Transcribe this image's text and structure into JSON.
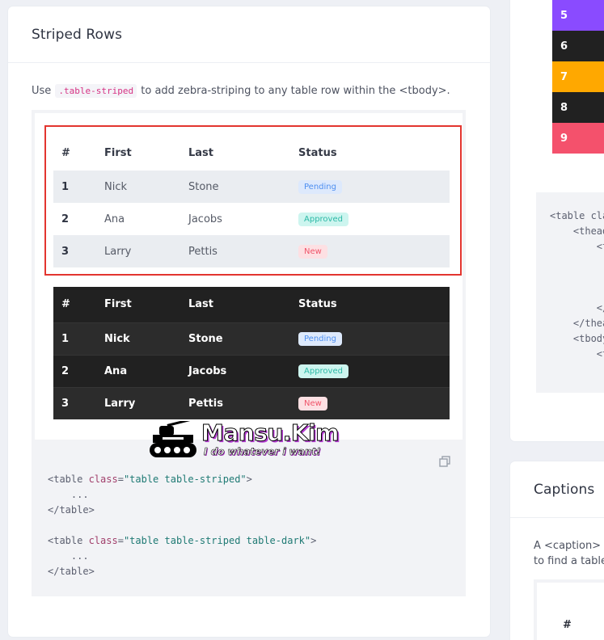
{
  "striped": {
    "title": "Striped Rows",
    "desc_prefix": "Use ",
    "desc_code": ".table-striped",
    "desc_suffix": " to add zebra-striping to any table row within the <tbody>.",
    "headers": [
      "#",
      "First",
      "Last",
      "Status"
    ],
    "rows": [
      {
        "num": "1",
        "first": "Nick",
        "last": "Stone",
        "status": "Pending"
      },
      {
        "num": "2",
        "first": "Ana",
        "last": "Jacobs",
        "status": "Approved"
      },
      {
        "num": "3",
        "first": "Larry",
        "last": "Pettis",
        "status": "New"
      }
    ],
    "code": {
      "l1_open": "<table ",
      "l1_attr": "class",
      "l1_eq": "=",
      "l1_str": "\"table table-striped\"",
      "l1_close": ">",
      "l2": "    ...",
      "l3": "</table>",
      "l5_open": "<table ",
      "l5_attr": "class",
      "l5_eq": "=",
      "l5_str": "\"table table-striped table-dark\"",
      "l5_close": ">",
      "l6": "    ...",
      "l7": "</table>"
    }
  },
  "watermark": {
    "title": "Mansu.Kim",
    "subtitle": "I do whatever i want!"
  },
  "right_panel": {
    "swatches": [
      {
        "label": "5",
        "color": "#8a4bff"
      },
      {
        "label": "6",
        "color": "#212121"
      },
      {
        "label": "7",
        "color": "#ffa800"
      },
      {
        "label": "8",
        "color": "#212121"
      },
      {
        "label": "9",
        "color": "#f4516c"
      }
    ],
    "code_lines": [
      "<table cla",
      "    <thead",
      "        <t",
      "        </",
      "    </thea",
      "    <tbody",
      "        <t"
    ]
  },
  "captions": {
    "title": "Captions",
    "desc_line1": "A <caption> fu",
    "desc_line2": "to find a table",
    "hash": "#"
  },
  "colors": {
    "highlight": "#e3352f",
    "pending": "#4e8ff0",
    "approved": "#2cb9a6",
    "new": "#f0566b"
  }
}
